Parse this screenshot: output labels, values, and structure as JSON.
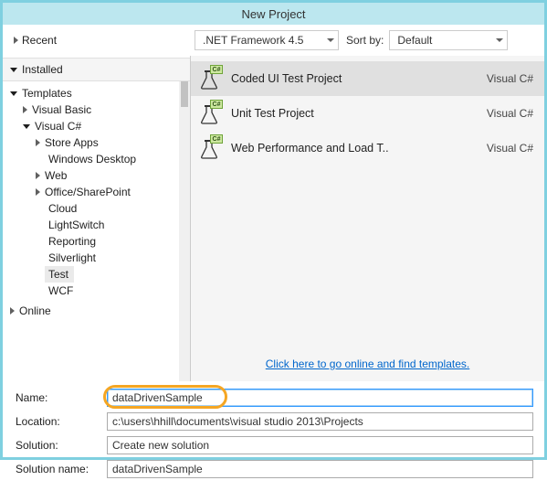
{
  "title": "New Project",
  "toolbar": {
    "recent_label": "Recent",
    "framework": ".NET Framework 4.5",
    "sortby_label": "Sort by:",
    "sort_value": "Default"
  },
  "sidebar": {
    "installed_label": "Installed",
    "templates_label": "Templates",
    "vb_label": "Visual Basic",
    "vcsharp_label": "Visual C#",
    "children": {
      "store_apps": "Store Apps",
      "windows_desktop": "Windows Desktop",
      "web": "Web",
      "office_sp": "Office/SharePoint",
      "cloud": "Cloud",
      "lightswitch": "LightSwitch",
      "reporting": "Reporting",
      "silverlight": "Silverlight",
      "test": "Test",
      "wcf": "WCF"
    },
    "online_label": "Online"
  },
  "templates": {
    "lang": "Visual C#",
    "coded_ui": "Coded UI Test Project",
    "unit_test": "Unit Test Project",
    "webperf": "Web Performance and Load T..",
    "badge": "C#"
  },
  "online_link": "Click here to go online and find templates.",
  "form": {
    "name_label": "Name:",
    "name_value": "dataDrivenSample",
    "location_label": "Location:",
    "location_value": "c:\\users\\hhill\\documents\\visual studio 2013\\Projects",
    "solution_label": "Solution:",
    "solution_value": "Create new solution",
    "solution_name_label": "Solution name:",
    "solution_name_value": "dataDrivenSample"
  }
}
